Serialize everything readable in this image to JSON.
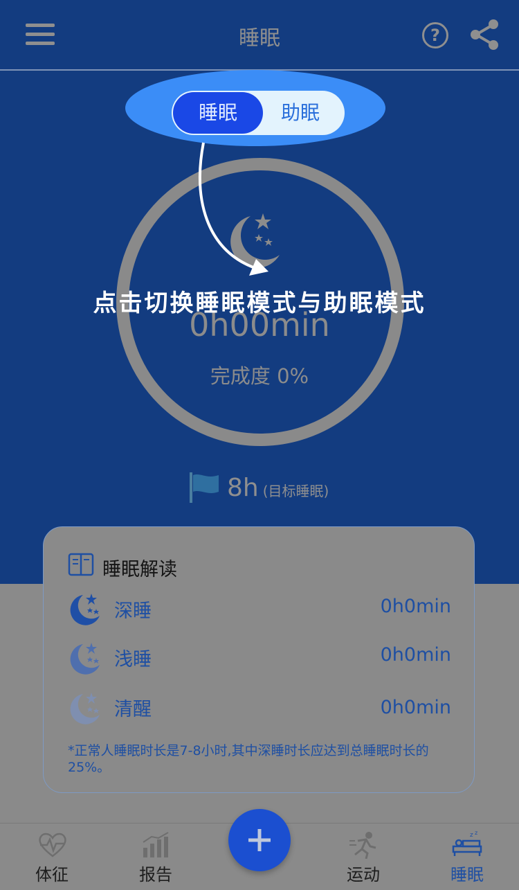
{
  "header": {
    "title": "睡眠",
    "menu_icon": "menu-icon",
    "help_icon": "help-icon",
    "share_icon": "share-icon"
  },
  "mode_toggle": {
    "sleep_label": "睡眠",
    "aid_label": "助眠",
    "selected": "睡眠"
  },
  "guide": {
    "text": "点击切换睡眠模式与助眠模式"
  },
  "summary": {
    "duration": "0h00min",
    "completion_label": "完成度 0%",
    "completion_percent": 0
  },
  "target": {
    "value": "8h",
    "label": "(目标睡眠)"
  },
  "card": {
    "title": "睡眠解读",
    "rows": [
      {
        "label": "深睡",
        "value": "0h0min"
      },
      {
        "label": "浅睡",
        "value": "0h0min"
      },
      {
        "label": "清醒",
        "value": "0h0min"
      }
    ],
    "note": "*正常人睡眠时长是7-8小时,其中深睡时长应达到总睡眠时长的25%。"
  },
  "tabs": [
    {
      "label": "体征",
      "icon": "heart-pulse-icon"
    },
    {
      "label": "报告",
      "icon": "bar-chart-icon"
    },
    {
      "label": "运动",
      "icon": "runner-icon"
    },
    {
      "label": "睡眠",
      "icon": "bed-icon",
      "active": true
    }
  ],
  "fab": {
    "icon": "plus-icon"
  },
  "colors": {
    "primary": "#133c80",
    "accent": "#1a48e6",
    "overlay": "#8a8a8a",
    "text_blue": "#1e4fa3"
  }
}
